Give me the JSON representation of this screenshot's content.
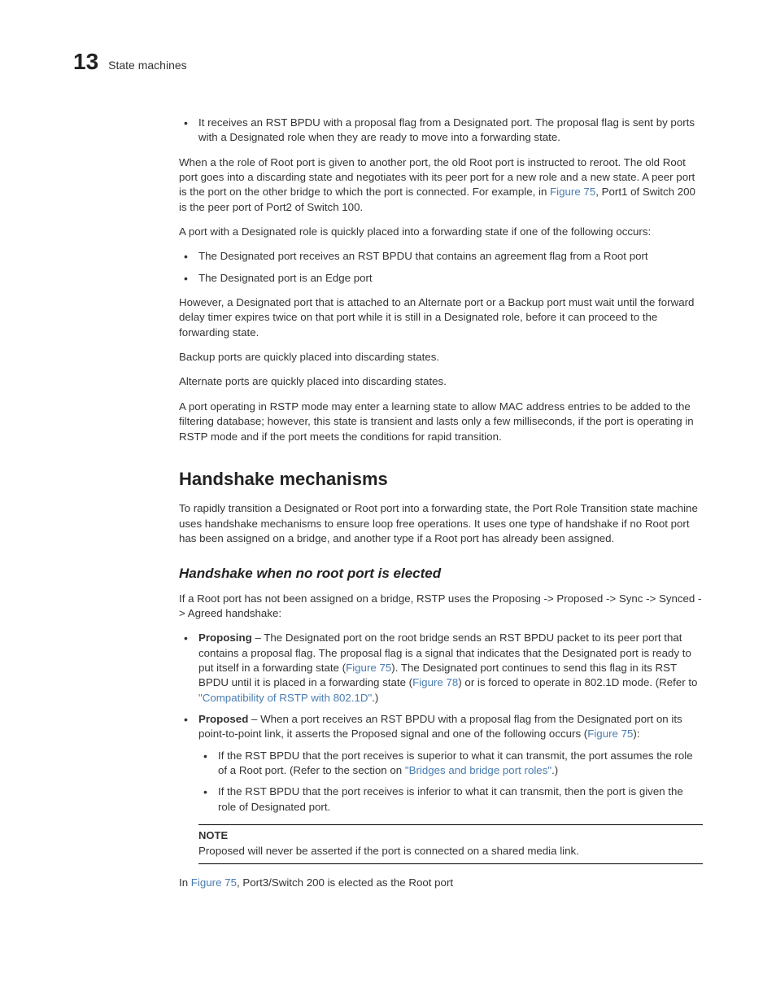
{
  "header": {
    "chapter_num": "13",
    "chapter_title": "State machines"
  },
  "b1": "It receives an RST BPDU with a proposal flag from a Designated port. The proposal flag is sent by ports with a Designated role when they are ready to move into a forwarding state.",
  "p1a": "When a the role of Root port is given to another port, the old Root port is instructed to reroot. The old Root port goes into a discarding state and negotiates with its peer port for a new role and a new state. A peer port is the port on the other bridge to which the port is connected. For example, in ",
  "p1_link": "Figure 75",
  "p1b": ", Port1 of Switch 200 is the peer port of Port2 of Switch 100.",
  "p2": "A port with a Designated role is quickly placed into a forwarding state if one of the following occurs:",
  "b2": "The Designated port receives an RST BPDU that contains an agreement flag from a Root port",
  "b3": "The Designated port is an Edge port",
  "p3": "However, a Designated port that is attached to an Alternate port or a Backup port must wait until the forward delay timer expires twice on that port while it is still in a Designated role, before it can proceed to the forwarding state.",
  "p4": "Backup ports are quickly placed into discarding states.",
  "p5": "Alternate ports are quickly placed into discarding states.",
  "p6": "A port operating in RSTP mode may enter a learning state to allow MAC address entries to be added to the filtering database; however, this state is transient and lasts only a few milliseconds, if the port is operating in RSTP mode and if the port meets the conditions for rapid transition.",
  "h2": "Handshake mechanisms",
  "p7": "To rapidly transition a Designated or Root port into a forwarding state, the Port Role Transition state machine uses handshake mechanisms to ensure loop free operations. It uses one type of handshake if no Root port has been assigned on a bridge, and another type if a Root port has already been assigned.",
  "h3": "Handshake when no root port is elected",
  "p8": "If a Root port has not been assigned on a bridge, RSTP uses the Proposing -> Proposed -> Sync -> Synced -> Agreed handshake:",
  "prop_label": "Proposing",
  "prop_a": " – The Designated port on the root bridge sends an RST BPDU packet to its peer port that contains a proposal flag. The proposal flag is a signal that indicates that the Designated port is ready to put itself in a forwarding state (",
  "prop_link1": "Figure 75",
  "prop_b": "). The Designated port continues to send this flag in its RST BPDU until it is placed in a forwarding state (",
  "prop_link2": "Figure 78",
  "prop_c": ") or is forced to operate in 802.1D mode. (Refer to ",
  "prop_link3": "\"Compatibility of RSTP with 802.1D\"",
  "prop_d": ".)",
  "propd_label": "Proposed",
  "propd_a": " – When a port receives an RST BPDU with a proposal flag from the Designated port on its point-to-point link, it asserts the Proposed signal and one of the following occurs (",
  "propd_link": "Figure 75",
  "propd_b": "):",
  "sub1a": "If the RST BPDU that the port receives is superior to what it can transmit, the port assumes the role of a Root port. (Refer to the section on ",
  "sub1_link": "\"Bridges and bridge port roles\"",
  "sub1b": ".)",
  "sub2": "If the RST BPDU that the port receives is inferior to what it can transmit, then the port is given the role of Designated port.",
  "note_title": "NOTE",
  "note_body": "Proposed will never be asserted if the port is connected on a shared media link.",
  "p9a": "In ",
  "p9_link": "Figure 75",
  "p9b": ", Port3/Switch 200 is elected as the Root port"
}
